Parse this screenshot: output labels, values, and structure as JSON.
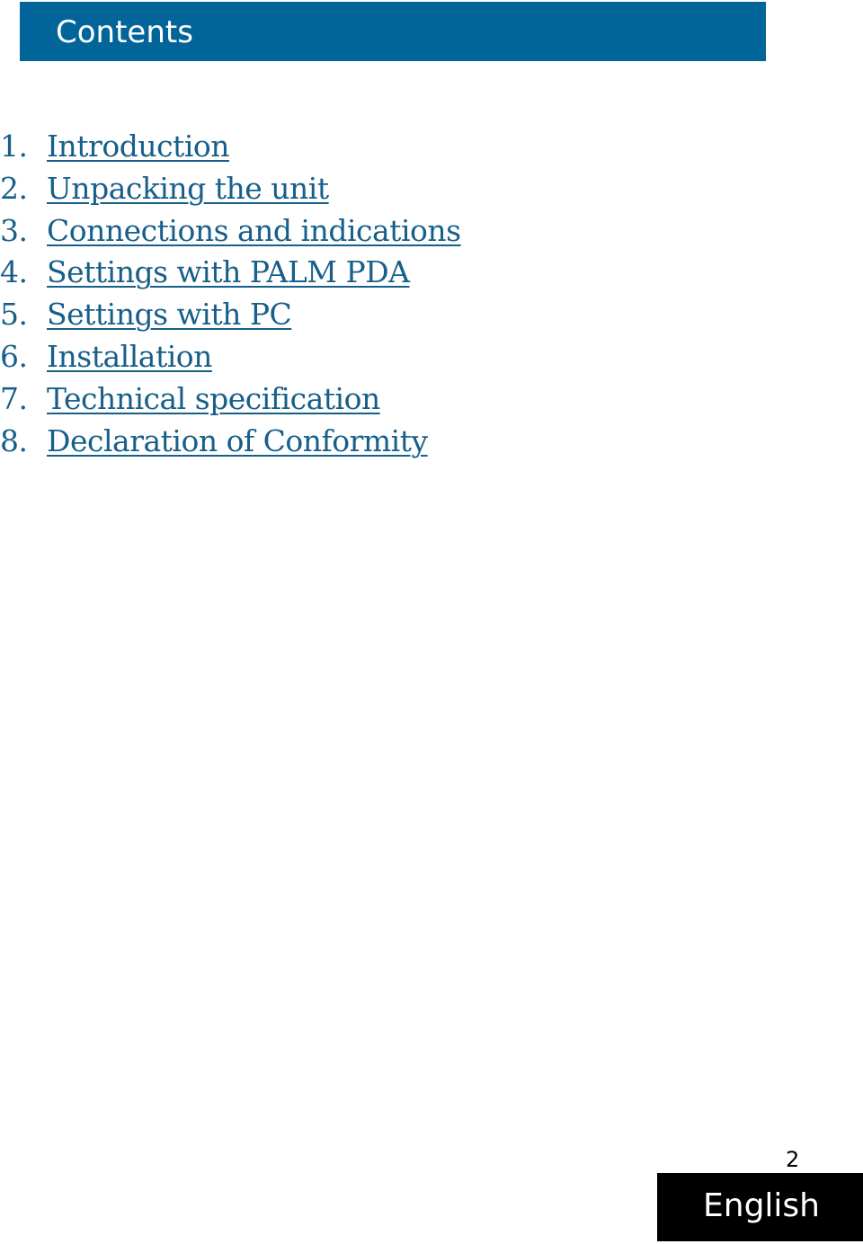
{
  "header": {
    "title": "Contents"
  },
  "toc": {
    "items": [
      {
        "number": "1.",
        "label": "Introduction"
      },
      {
        "number": "2.",
        "label": "Unpacking the unit"
      },
      {
        "number": "3.",
        "label": "Connections and indications"
      },
      {
        "number": "4.",
        "label": "Settings with PALM PDA"
      },
      {
        "number": "5.",
        "label": "Settings with PC"
      },
      {
        "number": "6.",
        "label": "Installation"
      },
      {
        "number": "7.",
        "label": "Technical specification"
      },
      {
        "number": "8.",
        "label": "Declaration of Conformity"
      }
    ]
  },
  "footer": {
    "page_number": "2",
    "language": "English"
  },
  "colors": {
    "header_bg": "#02659a",
    "link": "#175f8a",
    "language_bg": "#000000"
  }
}
